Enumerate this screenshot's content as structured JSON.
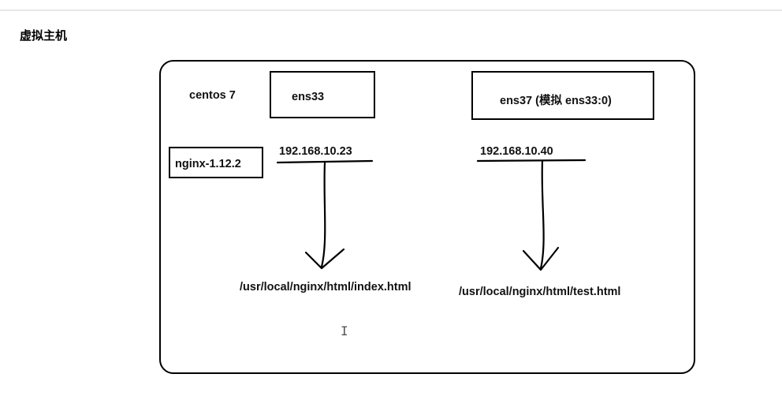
{
  "title": "虚拟主机",
  "os_label": "centos 7",
  "nginx_label": "nginx-1.12.2",
  "iface1_label": "ens33",
  "iface2_label": "ens37  (模拟 ens33:0)",
  "ip1": "192.168.10.23",
  "ip2": "192.168.10.40",
  "path1": "/usr/local/nginx/html/index.html",
  "path2": "/usr/local/nginx/html/test.html"
}
